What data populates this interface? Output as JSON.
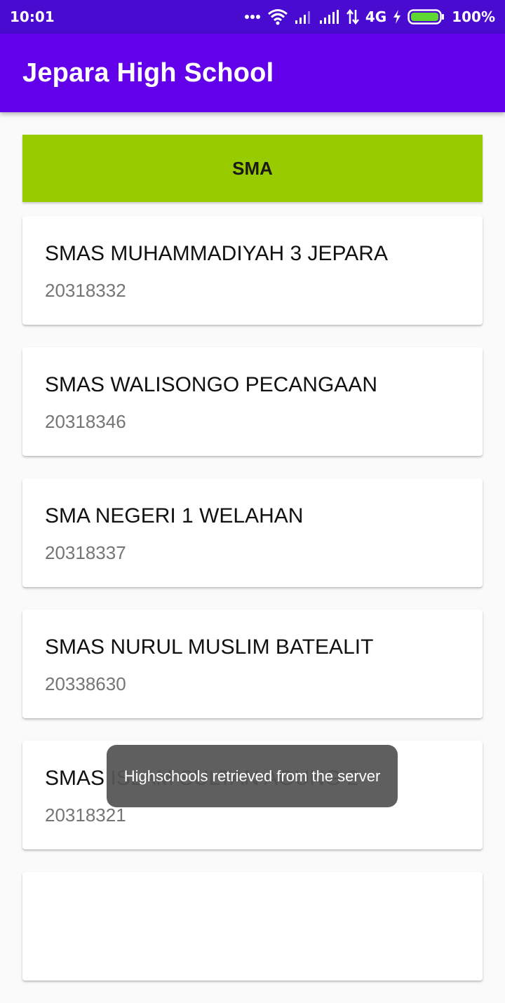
{
  "status_bar": {
    "time": "10:01",
    "network": "4G",
    "battery": "100%",
    "icons": [
      "more-dots-icon",
      "wifi-icon",
      "signal-1-icon",
      "signal-2-icon",
      "data-arrows-icon",
      "charging-bolt-icon",
      "battery-icon"
    ]
  },
  "app_bar": {
    "title": "Jepara High School"
  },
  "section": {
    "label": "SMA"
  },
  "schools": [
    {
      "name": "SMAS MUHAMMADIYAH 3 JEPARA",
      "id": "20318332"
    },
    {
      "name": "SMAS WALISONGO PECANGAAN",
      "id": "20318346"
    },
    {
      "name": "SMA NEGERI 1 WELAHAN",
      "id": "20318337"
    },
    {
      "name": "SMAS NURUL MUSLIM BATEALIT",
      "id": "20338630"
    },
    {
      "name": "SMAS ISLAM SULTAN AGUNG 2",
      "id": "20318321"
    }
  ],
  "toast": {
    "message": "Highschools retrieved from the server"
  },
  "colors": {
    "status_bar": "#4a0bd0",
    "app_bar": "#6200ea",
    "section_header": "#99cc00",
    "battery_fill": "#5fd82f"
  }
}
